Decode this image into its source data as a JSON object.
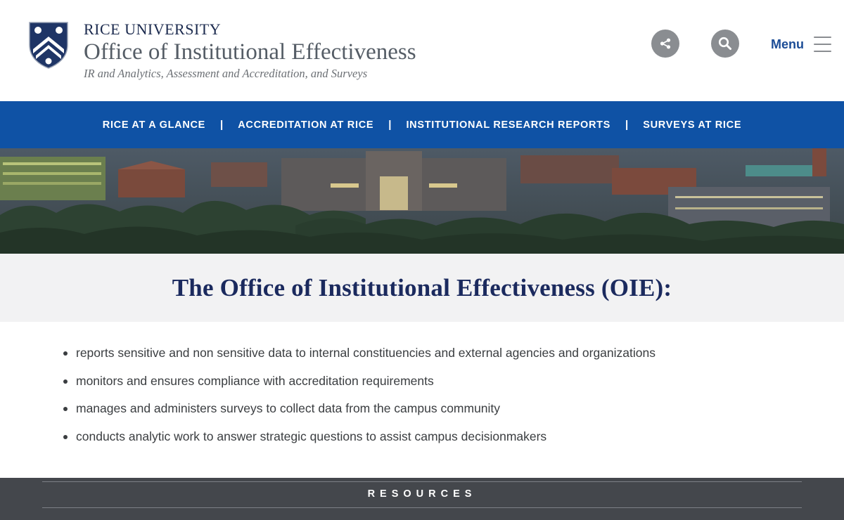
{
  "header": {
    "university": "RICE UNIVERSITY",
    "office": "Office of Institutional Effectiveness",
    "tagline": "IR and Analytics, Assessment and Accreditation, and Surveys",
    "menu_label": "Menu",
    "icons": {
      "logo": "rice-shield-logo",
      "share": "share-icon",
      "search": "search-icon",
      "menu": "hamburger-icon"
    }
  },
  "nav": {
    "items": [
      {
        "label": "RICE AT A GLANCE"
      },
      {
        "label": "ACCREDITATION AT RICE"
      },
      {
        "label": "INSTITUTIONAL RESEARCH REPORTS"
      },
      {
        "label": "SURVEYS AT RICE"
      }
    ],
    "separator": "|"
  },
  "main": {
    "title": "The Office of Institutional Effectiveness (OIE):",
    "bullets": [
      "reports sensitive and non sensitive data to internal constituencies and external agencies and organizations",
      "monitors and ensures compliance with accreditation requirements",
      "manages and administers surveys to collect data from the campus community",
      "conducts analytic work to answer strategic questions to assist campus decisionmakers"
    ]
  },
  "resources": {
    "label": "RESOURCES"
  },
  "colors": {
    "nav_blue": "#0f52a5",
    "navy_text": "#1b2a5e",
    "menu_blue": "#1b4c96",
    "icon_gray": "#8a8d91",
    "footer_dark": "#44474c",
    "title_band": "#f2f2f3"
  }
}
